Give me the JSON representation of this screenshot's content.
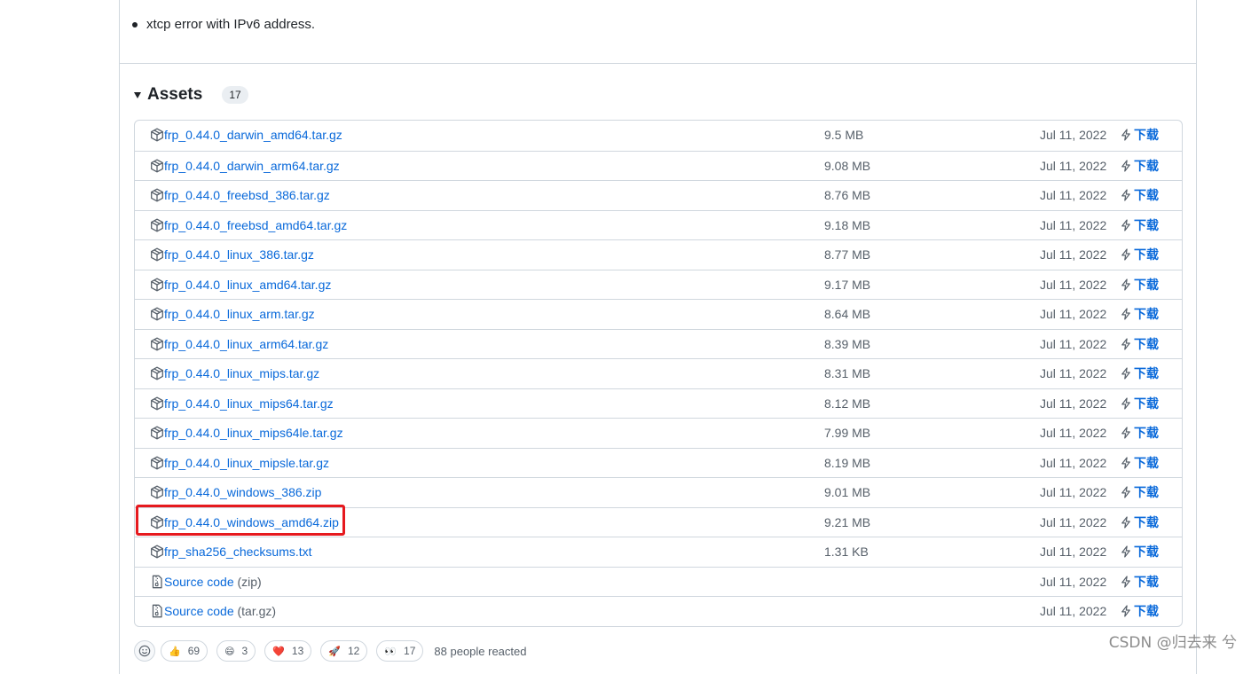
{
  "release_notes": {
    "items": [
      "xtcp error with IPv6 address."
    ]
  },
  "assets": {
    "title": "Assets",
    "count": "17",
    "download_label": "下载",
    "rows": [
      {
        "name": "frp_0.44.0_darwin_amd64.tar.gz",
        "suffix": "",
        "size": "9.5 MB",
        "date": "Jul 11, 2022",
        "icon": "package-icon"
      },
      {
        "name": "frp_0.44.0_darwin_arm64.tar.gz",
        "suffix": "",
        "size": "9.08 MB",
        "date": "Jul 11, 2022",
        "icon": "package-icon"
      },
      {
        "name": "frp_0.44.0_freebsd_386.tar.gz",
        "suffix": "",
        "size": "8.76 MB",
        "date": "Jul 11, 2022",
        "icon": "package-icon"
      },
      {
        "name": "frp_0.44.0_freebsd_amd64.tar.gz",
        "suffix": "",
        "size": "9.18 MB",
        "date": "Jul 11, 2022",
        "icon": "package-icon"
      },
      {
        "name": "frp_0.44.0_linux_386.tar.gz",
        "suffix": "",
        "size": "8.77 MB",
        "date": "Jul 11, 2022",
        "icon": "package-icon"
      },
      {
        "name": "frp_0.44.0_linux_amd64.tar.gz",
        "suffix": "",
        "size": "9.17 MB",
        "date": "Jul 11, 2022",
        "icon": "package-icon"
      },
      {
        "name": "frp_0.44.0_linux_arm.tar.gz",
        "suffix": "",
        "size": "8.64 MB",
        "date": "Jul 11, 2022",
        "icon": "package-icon"
      },
      {
        "name": "frp_0.44.0_linux_arm64.tar.gz",
        "suffix": "",
        "size": "8.39 MB",
        "date": "Jul 11, 2022",
        "icon": "package-icon"
      },
      {
        "name": "frp_0.44.0_linux_mips.tar.gz",
        "suffix": "",
        "size": "8.31 MB",
        "date": "Jul 11, 2022",
        "icon": "package-icon"
      },
      {
        "name": "frp_0.44.0_linux_mips64.tar.gz",
        "suffix": "",
        "size": "8.12 MB",
        "date": "Jul 11, 2022",
        "icon": "package-icon"
      },
      {
        "name": "frp_0.44.0_linux_mips64le.tar.gz",
        "suffix": "",
        "size": "7.99 MB",
        "date": "Jul 11, 2022",
        "icon": "package-icon"
      },
      {
        "name": "frp_0.44.0_linux_mipsle.tar.gz",
        "suffix": "",
        "size": "8.19 MB",
        "date": "Jul 11, 2022",
        "icon": "package-icon"
      },
      {
        "name": "frp_0.44.0_windows_386.zip",
        "suffix": "",
        "size": "9.01 MB",
        "date": "Jul 11, 2022",
        "icon": "package-icon"
      },
      {
        "name": "frp_0.44.0_windows_amd64.zip",
        "suffix": "",
        "size": "9.21 MB",
        "date": "Jul 11, 2022",
        "icon": "package-icon",
        "highlighted": true
      },
      {
        "name": "frp_sha256_checksums.txt",
        "suffix": "",
        "size": "1.31 KB",
        "date": "Jul 11, 2022",
        "icon": "package-icon"
      },
      {
        "name": "Source code",
        "suffix": " (zip)",
        "size": "",
        "date": "Jul 11, 2022",
        "icon": "file-zip-icon"
      },
      {
        "name": "Source code",
        "suffix": " (tar.gz)",
        "size": "",
        "date": "Jul 11, 2022",
        "icon": "file-zip-icon"
      }
    ]
  },
  "reactions": {
    "items": [
      {
        "emoji": "👍",
        "icon": "thumbs-up-icon",
        "count": "69"
      },
      {
        "emoji": "😄",
        "icon": "laugh-icon",
        "count": "3"
      },
      {
        "emoji": "❤️",
        "icon": "heart-icon",
        "count": "13"
      },
      {
        "emoji": "🚀",
        "icon": "rocket-icon",
        "count": "12"
      },
      {
        "emoji": "👀",
        "icon": "eyes-icon",
        "count": "17"
      }
    ],
    "summary": "88 people reacted"
  },
  "watermark": "CSDN @归去来 兮",
  "colors": {
    "link": "#0969da",
    "muted": "#57606a",
    "border": "#d0d7de",
    "highlight": "#e6191e"
  }
}
